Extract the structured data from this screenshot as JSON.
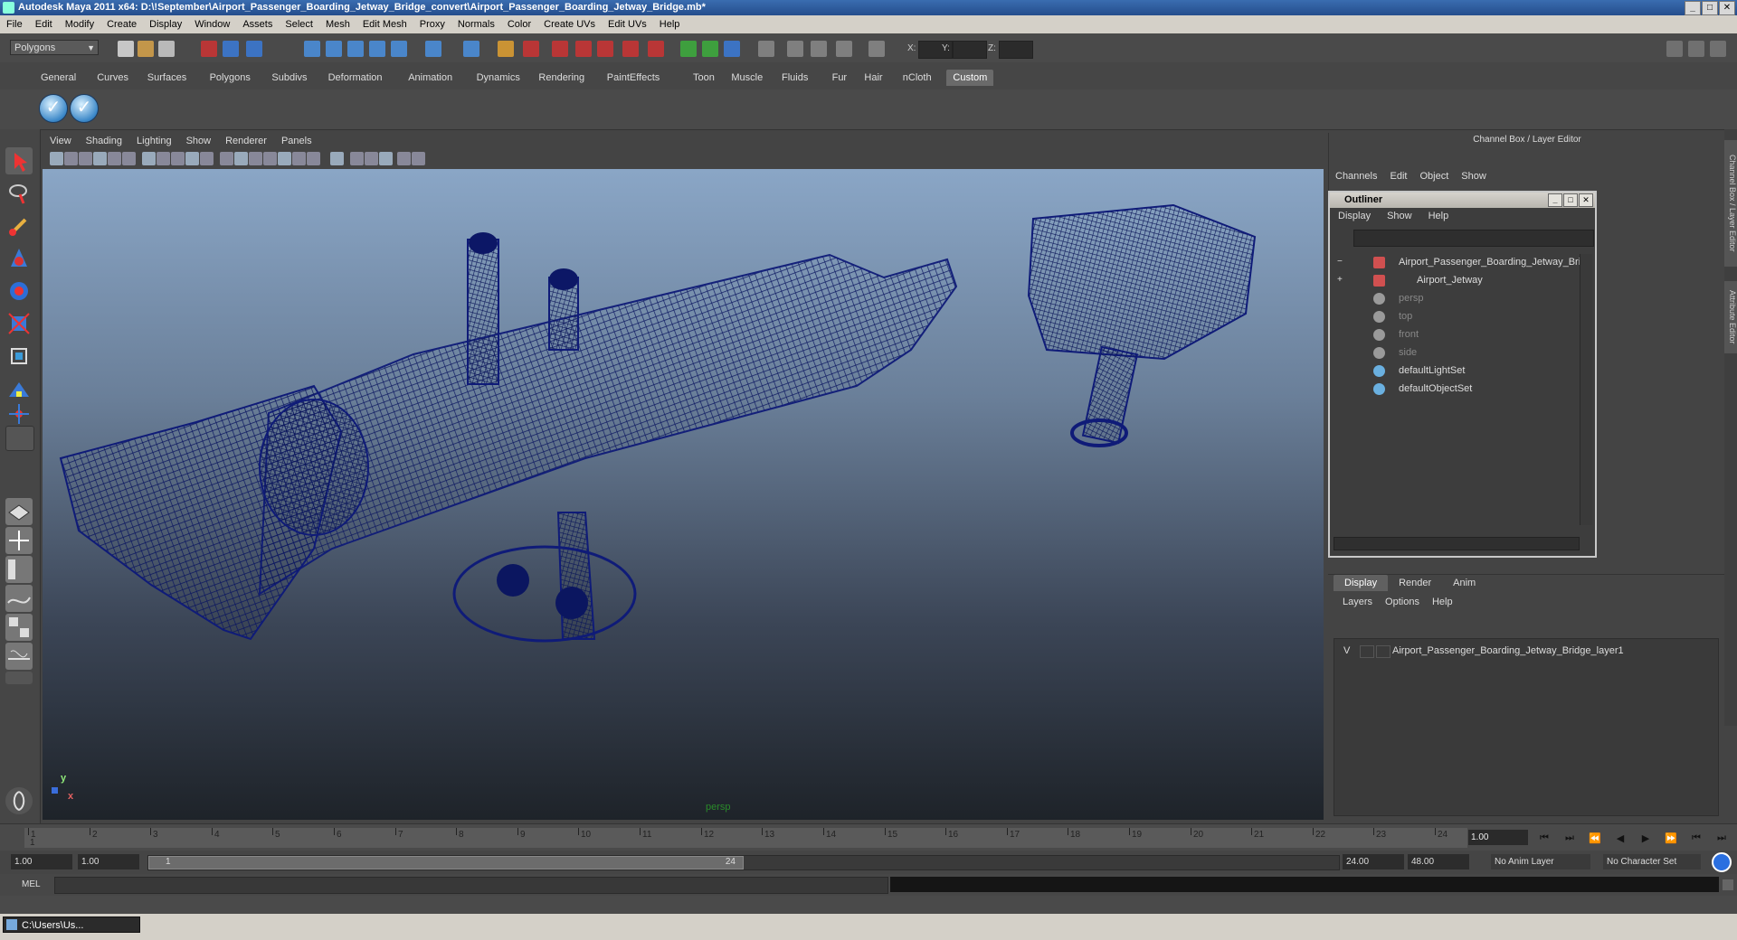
{
  "window": {
    "title": "Autodesk Maya 2011 x64: D:\\!September\\Airport_Passenger_Boarding_Jetway_Bridge_convert\\Airport_Passenger_Boarding_Jetway_Bridge.mb*",
    "min": "_",
    "max": "□",
    "close": "✕"
  },
  "menubar": [
    "File",
    "Edit",
    "Modify",
    "Create",
    "Display",
    "Window",
    "Assets",
    "Select",
    "Mesh",
    "Edit Mesh",
    "Proxy",
    "Normals",
    "Color",
    "Create UVs",
    "Edit UVs",
    "Help"
  ],
  "status": {
    "mode": "Polygons",
    "x_label": "X:",
    "y_label": "Y:",
    "z_label": "Z:"
  },
  "shelf_tabs": [
    "General",
    "Curves",
    "Surfaces",
    "Polygons",
    "Subdivs",
    "Deformation",
    "Animation",
    "Dynamics",
    "Rendering",
    "PaintEffects",
    "Toon",
    "Muscle",
    "Fluids",
    "Fur",
    "Hair",
    "nCloth",
    "Custom"
  ],
  "shelf_active": "Custom",
  "shelf_buttons": [
    "✓",
    "✓"
  ],
  "viewport": {
    "menu": [
      "View",
      "Shading",
      "Lighting",
      "Show",
      "Renderer",
      "Panels"
    ],
    "camera": "persp",
    "axis_y": "y",
    "axis_x": "x",
    "wire_color": "#0e1a72"
  },
  "channel_box": {
    "title": "Channel Box / Layer Editor",
    "menu": [
      "Channels",
      "Edit",
      "Object",
      "Show"
    ]
  },
  "outliner": {
    "title": "Outliner",
    "menu": [
      "Display",
      "Show",
      "Help"
    ],
    "items": [
      {
        "name": "Airport_Passenger_Boarding_Jetway_Brid",
        "icon": "transform-icon",
        "expand": "−",
        "dim": false
      },
      {
        "name": "Airport_Jetway",
        "icon": "transform-icon",
        "expand": "+",
        "dim": false
      },
      {
        "name": "persp",
        "icon": "camera-icon",
        "expand": "",
        "dim": true
      },
      {
        "name": "top",
        "icon": "camera-icon",
        "expand": "",
        "dim": true
      },
      {
        "name": "front",
        "icon": "camera-icon",
        "expand": "",
        "dim": true
      },
      {
        "name": "side",
        "icon": "camera-icon",
        "expand": "",
        "dim": true
      },
      {
        "name": "defaultLightSet",
        "icon": "set-icon",
        "expand": "",
        "dim": false
      },
      {
        "name": "defaultObjectSet",
        "icon": "set-icon",
        "expand": "",
        "dim": false
      }
    ]
  },
  "layer_editor": {
    "tabs": [
      "Display",
      "Render",
      "Anim"
    ],
    "active_tab": "Display",
    "menu": [
      "Layers",
      "Options",
      "Help"
    ],
    "layers": [
      {
        "v": "V",
        "name": "Airport_Passenger_Boarding_Jetway_Bridge_layer1"
      }
    ]
  },
  "right_tabs": [
    "Channel Box / Layer Editor",
    "Attribute Editor"
  ],
  "timeline": {
    "ticks": [
      "1",
      "2",
      "3",
      "4",
      "5",
      "6",
      "7",
      "8",
      "9",
      "10",
      "11",
      "12",
      "13",
      "14",
      "15",
      "16",
      "17",
      "18",
      "19",
      "20",
      "21",
      "22",
      "23",
      "24"
    ],
    "current": "1",
    "current_frame_field": "1.00",
    "playback": [
      "⏮",
      "⏭",
      "⏪",
      "◀",
      "▶",
      "⏩",
      "⏮",
      "⏭"
    ]
  },
  "range": {
    "start": "1.00",
    "playback_start": "1.00",
    "knob_start": "1",
    "knob_end": "24",
    "playback_end": "24.00",
    "end": "48.00",
    "anim_layer": "No Anim Layer",
    "char_set": "No Character Set"
  },
  "command": {
    "label": "MEL"
  },
  "taskbar": {
    "item": "C:\\Users\\Us..."
  }
}
